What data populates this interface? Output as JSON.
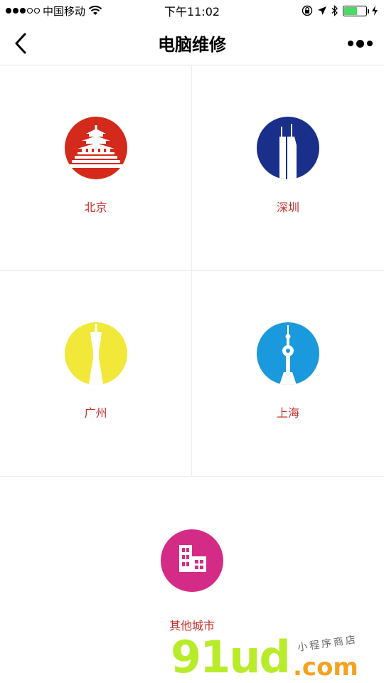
{
  "status_bar": {
    "carrier": "中国移动",
    "time": "下午11:02",
    "battery_level_percent": 60
  },
  "nav": {
    "title": "电脑维修"
  },
  "cities": [
    {
      "label": "北京",
      "color": "#d42a1c",
      "icon": "temple-of-heaven-icon"
    },
    {
      "label": "深圳",
      "color": "#1a2f8a",
      "icon": "skyscraper-icon"
    },
    {
      "label": "广州",
      "color": "#f2e83a",
      "icon": "canton-tower-icon"
    },
    {
      "label": "上海",
      "color": "#1a99dc",
      "icon": "oriental-pearl-tower-icon"
    },
    {
      "label": "其他城市",
      "color": "#d42c86",
      "icon": "buildings-icon"
    }
  ],
  "watermark": {
    "logo": "91ud",
    "suffix": ".com",
    "tagline": "小程序商店"
  },
  "colors": {
    "label": "#c9302c",
    "divider": "#ededed",
    "battery": "#4cd964"
  }
}
